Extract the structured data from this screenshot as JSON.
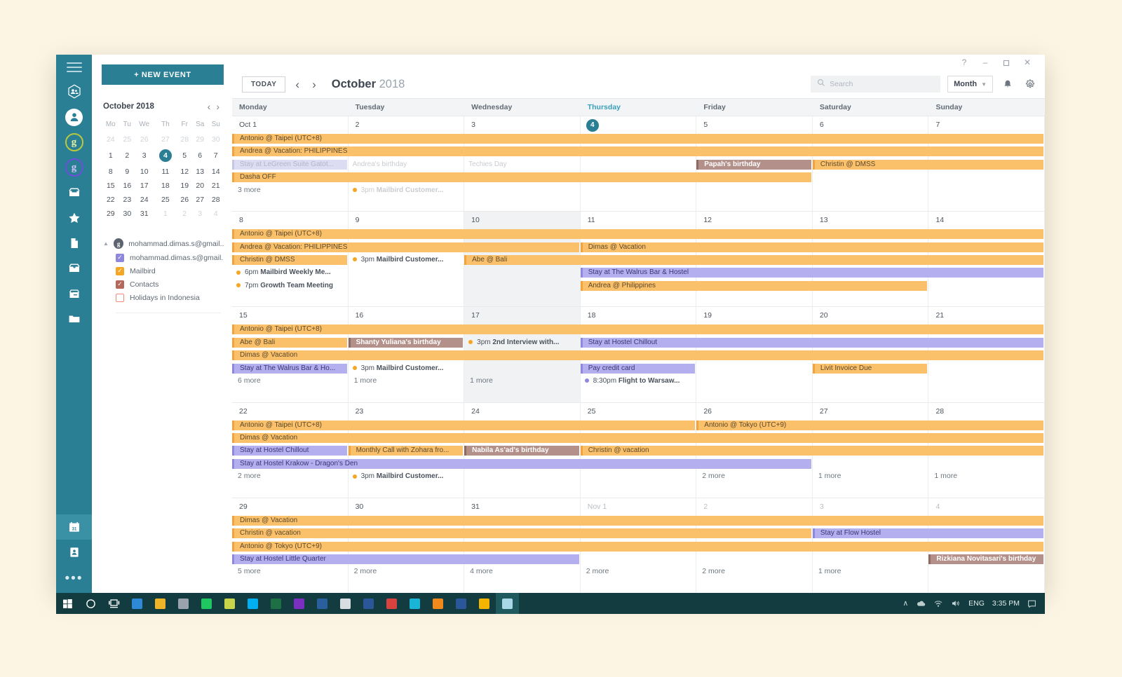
{
  "window": {
    "controls": [
      {
        "name": "help",
        "glyph": "?"
      },
      {
        "name": "minimize",
        "glyph": "–"
      },
      {
        "name": "maximize",
        "glyph": "❐"
      },
      {
        "name": "close",
        "glyph": "✕"
      }
    ]
  },
  "rail": {
    "icons": [
      {
        "name": "contacts-group-icon",
        "type": "hex-people"
      },
      {
        "name": "account-avatar-icon",
        "type": "avatar"
      },
      {
        "name": "google-account-1-icon",
        "type": "g-ring",
        "color": "#b9c93f",
        "letter": "g"
      },
      {
        "name": "google-account-2-icon",
        "type": "g-ring-violet",
        "color": "#6b4fd8",
        "letter": "g"
      },
      {
        "name": "inbox-icon",
        "type": "inbox"
      },
      {
        "name": "favorites-star-icon",
        "type": "star"
      },
      {
        "name": "drafts-page-icon",
        "type": "page"
      },
      {
        "name": "archive-icon",
        "type": "archive"
      },
      {
        "name": "snoozed-icon",
        "type": "snooze"
      },
      {
        "name": "folder-icon",
        "type": "folder"
      }
    ],
    "bottom_icons": [
      {
        "name": "calendar-icon",
        "type": "calendar",
        "active": true
      },
      {
        "name": "contacts-book-icon",
        "type": "contact-card",
        "active": false
      }
    ],
    "more_glyph": "•••"
  },
  "left_panel": {
    "new_event_label": "+ NEW EVENT",
    "mini_calendar": {
      "title": "October 2018",
      "prev_glyph": "‹",
      "next_glyph": "›",
      "weekday_headers": [
        "Mo",
        "Tu",
        "We",
        "Th",
        "Fr",
        "Sa",
        "Su"
      ],
      "weeks": [
        [
          {
            "d": "24",
            "m": true
          },
          {
            "d": "25",
            "m": true
          },
          {
            "d": "26",
            "m": true
          },
          {
            "d": "27",
            "m": true
          },
          {
            "d": "28",
            "m": true
          },
          {
            "d": "29",
            "m": true
          },
          {
            "d": "30",
            "m": true
          }
        ],
        [
          {
            "d": "1"
          },
          {
            "d": "2"
          },
          {
            "d": "3"
          },
          {
            "d": "4",
            "today": true
          },
          {
            "d": "5"
          },
          {
            "d": "6"
          },
          {
            "d": "7"
          }
        ],
        [
          {
            "d": "8"
          },
          {
            "d": "9"
          },
          {
            "d": "10"
          },
          {
            "d": "11"
          },
          {
            "d": "12"
          },
          {
            "d": "13"
          },
          {
            "d": "14"
          }
        ],
        [
          {
            "d": "15"
          },
          {
            "d": "16"
          },
          {
            "d": "17"
          },
          {
            "d": "18"
          },
          {
            "d": "19"
          },
          {
            "d": "20"
          },
          {
            "d": "21"
          }
        ],
        [
          {
            "d": "22"
          },
          {
            "d": "23"
          },
          {
            "d": "24"
          },
          {
            "d": "25"
          },
          {
            "d": "26"
          },
          {
            "d": "27"
          },
          {
            "d": "28"
          }
        ],
        [
          {
            "d": "29"
          },
          {
            "d": "30"
          },
          {
            "d": "31"
          },
          {
            "d": "1",
            "m": true
          },
          {
            "d": "2",
            "m": true
          },
          {
            "d": "3",
            "m": true
          },
          {
            "d": "4",
            "m": true
          }
        ]
      ]
    },
    "account": {
      "caret_glyph": "▲",
      "initial": "g",
      "label": "mohammad.dimas.s@gmail...."
    },
    "calendars": [
      {
        "label": "mohammad.dimas.s@gmail....",
        "checked": true,
        "color": "#8e87e0",
        "check": "✓"
      },
      {
        "label": "Mailbird",
        "checked": true,
        "color": "#f5a623",
        "check": "✓"
      },
      {
        "label": "Contacts",
        "checked": true,
        "color": "#b5675a",
        "check": "✓"
      },
      {
        "label": "Holidays in Indonesia",
        "checked": false,
        "color": "#f08a7a",
        "check": ""
      }
    ]
  },
  "toolbar": {
    "today_label": "TODAY",
    "prev_glyph": "‹",
    "next_glyph": "›",
    "month": "October",
    "year": "2018",
    "search_placeholder": "Search",
    "search_value": "",
    "search_icon": "search-icon",
    "view_label": "Month",
    "view_chevron": "▼",
    "bell_icon": "notifications-bell-icon",
    "gear_icon": "settings-gear-icon"
  },
  "calendar": {
    "weekday_headers": [
      {
        "label": "Monday",
        "today": false
      },
      {
        "label": "Tuesday",
        "today": false
      },
      {
        "label": "Wednesday",
        "today": false
      },
      {
        "label": "Thursday",
        "today": true
      },
      {
        "label": "Friday",
        "today": false
      },
      {
        "label": "Saturday",
        "today": false
      },
      {
        "label": "Sunday",
        "today": false
      }
    ],
    "weeks": [
      {
        "days": [
          {
            "num": "Oct 1"
          },
          {
            "num": "2"
          },
          {
            "num": "3"
          },
          {
            "num": "4",
            "today": true
          },
          {
            "num": "5"
          },
          {
            "num": "6"
          },
          {
            "num": "7"
          }
        ],
        "bands": [
          {
            "label": "Antonio @ Taipei (UTC+8)",
            "style": "orange",
            "start": 0,
            "span": 7,
            "row": 0
          },
          {
            "label": "Andrea @ Vacation: PHILIPPINES",
            "style": "orange",
            "start": 0,
            "span": 7,
            "row": 1
          },
          {
            "label": "Stay at LeGreen Suite Gatot...",
            "style": "lilac-faded",
            "start": 0,
            "span": 1,
            "row": 2
          },
          {
            "label": "Andrea's birthday",
            "style": "plain faded",
            "start": 1,
            "span": 1,
            "row": 2
          },
          {
            "label": "Techies Day",
            "style": "plain faded",
            "start": 2,
            "span": 1,
            "row": 2
          },
          {
            "label": "Papah's birthday",
            "style": "brown",
            "start": 4,
            "span": 1,
            "row": 2
          },
          {
            "label": "Christin @ DMSS",
            "style": "orange",
            "start": 5,
            "span": 2,
            "row": 2
          },
          {
            "label": "Dasha OFF",
            "style": "orange",
            "start": 0,
            "span": 5,
            "row": 3
          }
        ],
        "timed": [
          {
            "label": "3pm Mailbird Customer...",
            "time": "3pm",
            "name": "Mailbird Customer...",
            "dot": "orange",
            "start": 1,
            "row": 4,
            "faded": true
          }
        ],
        "more": [
          {
            "label": "3 more",
            "start": 0,
            "row": 4
          }
        ]
      },
      {
        "days": [
          {
            "num": "8"
          },
          {
            "num": "9"
          },
          {
            "num": "10",
            "shaded": true
          },
          {
            "num": "11"
          },
          {
            "num": "12"
          },
          {
            "num": "13"
          },
          {
            "num": "14"
          }
        ],
        "bands": [
          {
            "label": "Antonio @ Taipei (UTC+8)",
            "style": "orange",
            "start": 0,
            "span": 7,
            "row": 0
          },
          {
            "label": "Andrea @ Vacation: PHILIPPINES",
            "style": "orange",
            "start": 0,
            "span": 3,
            "row": 1
          },
          {
            "label": "Dimas @ Vacation",
            "style": "orange",
            "start": 3,
            "span": 4,
            "row": 1
          },
          {
            "label": "Christin @ DMSS",
            "style": "orange",
            "start": 0,
            "span": 1,
            "row": 2
          },
          {
            "label": "Abe @ Bali",
            "style": "orange",
            "start": 2,
            "span": 5,
            "row": 2
          },
          {
            "label": "Stay at The Walrus Bar & Hostel",
            "style": "purple",
            "start": 3,
            "span": 4,
            "row": 3
          },
          {
            "label": "Andrea @ Philippines",
            "style": "orange",
            "start": 3,
            "span": 3,
            "row": 4
          }
        ],
        "timed": [
          {
            "label": "3pm Mailbird Customer...",
            "time": "3pm",
            "name": "Mailbird Customer...",
            "dot": "orange",
            "start": 1,
            "row": 2
          },
          {
            "label": "6pm Mailbird Weekly Me...",
            "time": "6pm",
            "name": "Mailbird Weekly Me...",
            "dot": "orange",
            "start": 0,
            "row": 3
          },
          {
            "label": "7pm Growth Team Meeting",
            "time": "7pm",
            "name": "Growth Team Meeting",
            "dot": "orange",
            "start": 0,
            "row": 4
          }
        ],
        "more": []
      },
      {
        "days": [
          {
            "num": "15"
          },
          {
            "num": "16"
          },
          {
            "num": "17",
            "shaded": true
          },
          {
            "num": "18"
          },
          {
            "num": "19"
          },
          {
            "num": "20"
          },
          {
            "num": "21"
          }
        ],
        "bands": [
          {
            "label": "Antonio @ Taipei (UTC+8)",
            "style": "orange",
            "start": 0,
            "span": 7,
            "row": 0
          },
          {
            "label": "Abe @ Bali",
            "style": "orange",
            "start": 0,
            "span": 1,
            "row": 1
          },
          {
            "label": "Shanty Yuliana's birthday",
            "style": "brown",
            "start": 1,
            "span": 1,
            "row": 1
          },
          {
            "label": "Stay at Hostel Chillout",
            "style": "purple",
            "start": 3,
            "span": 4,
            "row": 1
          },
          {
            "label": "Dimas @ Vacation",
            "style": "orange",
            "start": 0,
            "span": 7,
            "row": 2
          },
          {
            "label": "Stay at The Walrus Bar & Ho...",
            "style": "purple",
            "start": 0,
            "span": 1,
            "row": 3
          },
          {
            "label": "Pay credit card",
            "style": "purple",
            "start": 3,
            "span": 1,
            "row": 3
          },
          {
            "label": "Livit Invoice Due",
            "style": "orange",
            "start": 5,
            "span": 1,
            "row": 3
          }
        ],
        "timed": [
          {
            "label": "3pm 2nd Interview with...",
            "time": "3pm",
            "name": "2nd Interview with...",
            "dot": "orange",
            "start": 2,
            "row": 1
          },
          {
            "label": "3pm Mailbird Customer...",
            "time": "3pm",
            "name": "Mailbird Customer...",
            "dot": "orange",
            "start": 1,
            "row": 3
          },
          {
            "label": "8:30pm Flight to Warsaw...",
            "time": "8:30pm",
            "name": "Flight to Warsaw...",
            "dot": "violet",
            "start": 3,
            "row": 4
          }
        ],
        "more": [
          {
            "label": "6 more",
            "start": 0,
            "row": 4
          },
          {
            "label": "1 more",
            "start": 1,
            "row": 4
          },
          {
            "label": "1 more",
            "start": 2,
            "row": 4
          }
        ]
      },
      {
        "days": [
          {
            "num": "22"
          },
          {
            "num": "23"
          },
          {
            "num": "24"
          },
          {
            "num": "25"
          },
          {
            "num": "26"
          },
          {
            "num": "27"
          },
          {
            "num": "28"
          }
        ],
        "bands": [
          {
            "label": "Antonio @ Taipei (UTC+8)",
            "style": "orange",
            "start": 0,
            "span": 4,
            "row": 0
          },
          {
            "label": "Antonio @ Tokyo (UTC+9)",
            "style": "orange",
            "start": 4,
            "span": 3,
            "row": 0
          },
          {
            "label": "Dimas @ Vacation",
            "style": "orange",
            "start": 0,
            "span": 7,
            "row": 1
          },
          {
            "label": "Stay at Hostel Chillout",
            "style": "purple",
            "start": 0,
            "span": 1,
            "row": 2
          },
          {
            "label": "Monthly Call with Zohara fro...",
            "style": "orange",
            "start": 1,
            "span": 1,
            "row": 2
          },
          {
            "label": "Nabila As'ad's birthday",
            "style": "brown",
            "start": 2,
            "span": 1,
            "row": 2
          },
          {
            "label": "Christin @ vacation",
            "style": "orange",
            "start": 3,
            "span": 4,
            "row": 2
          },
          {
            "label": "Stay at Hostel Krakow - Dragon's Den",
            "style": "purple",
            "start": 0,
            "span": 5,
            "row": 3
          }
        ],
        "timed": [
          {
            "label": "3pm Mailbird Customer...",
            "time": "3pm",
            "name": "Mailbird Customer...",
            "dot": "orange",
            "start": 1,
            "row": 4
          }
        ],
        "more": [
          {
            "label": "2 more",
            "start": 0,
            "row": 4
          },
          {
            "label": "2 more",
            "start": 4,
            "row": 4
          },
          {
            "label": "1 more",
            "start": 5,
            "row": 4
          },
          {
            "label": "1 more",
            "start": 6,
            "row": 4
          }
        ]
      },
      {
        "days": [
          {
            "num": "29"
          },
          {
            "num": "30"
          },
          {
            "num": "31"
          },
          {
            "num": "Nov 1",
            "muted": true
          },
          {
            "num": "2",
            "muted": true
          },
          {
            "num": "3",
            "muted": true
          },
          {
            "num": "4",
            "muted": true
          }
        ],
        "bands": [
          {
            "label": "Dimas @ Vacation",
            "style": "orange",
            "start": 0,
            "span": 7,
            "row": 0
          },
          {
            "label": "Christin @ vacation",
            "style": "orange",
            "start": 0,
            "span": 5,
            "row": 1
          },
          {
            "label": "Stay at Flow Hostel",
            "style": "purple",
            "start": 5,
            "span": 2,
            "row": 1
          },
          {
            "label": "Antonio @ Tokyo (UTC+9)",
            "style": "orange",
            "start": 0,
            "span": 7,
            "row": 2
          },
          {
            "label": "Stay at Hostel Little Quarter",
            "style": "purple",
            "start": 0,
            "span": 3,
            "row": 3
          },
          {
            "label": "Rizkiana Novitasari's birthday",
            "style": "brown",
            "start": 6,
            "span": 1,
            "row": 3
          }
        ],
        "timed": [],
        "more": [
          {
            "label": "5 more",
            "start": 0,
            "row": 4
          },
          {
            "label": "2 more",
            "start": 1,
            "row": 4
          },
          {
            "label": "4 more",
            "start": 2,
            "row": 4
          },
          {
            "label": "2 more",
            "start": 3,
            "row": 4
          },
          {
            "label": "2 more",
            "start": 4,
            "row": 4
          },
          {
            "label": "1 more",
            "start": 5,
            "row": 4
          }
        ]
      }
    ]
  },
  "taskbar": {
    "apps": [
      {
        "name": "start-button",
        "color": "#ffffff",
        "shape": "windows"
      },
      {
        "name": "cortana-search-icon",
        "color": "#ffffff",
        "shape": "circle"
      },
      {
        "name": "task-view-icon",
        "color": "#ffffff",
        "shape": "taskview"
      },
      {
        "name": "edge-icon",
        "color": "#2e8ad6"
      },
      {
        "name": "file-explorer-icon",
        "color": "#f0b429"
      },
      {
        "name": "browser-globe-icon",
        "color": "#9aa3ad"
      },
      {
        "name": "messenger-icon",
        "color": "#1ec760"
      },
      {
        "name": "notepad-icon",
        "color": "#c8d44a"
      },
      {
        "name": "skype-icon",
        "color": "#00aff0"
      },
      {
        "name": "excel-icon",
        "color": "#1d7044"
      },
      {
        "name": "onenote-icon",
        "color": "#7b2fbe"
      },
      {
        "name": "photoshop-icon",
        "color": "#2a5f9e"
      },
      {
        "name": "files-icon",
        "color": "#d8dde2"
      },
      {
        "name": "word-icon",
        "color": "#2b579a"
      },
      {
        "name": "opera-icon",
        "color": "#d9433f"
      },
      {
        "name": "handbrake-icon",
        "color": "#19b5d6"
      },
      {
        "name": "antivirus-icon",
        "color": "#f0881c"
      },
      {
        "name": "word-doc-icon",
        "color": "#2b579a"
      },
      {
        "name": "chrome-icon",
        "color": "#f4b400"
      },
      {
        "name": "mailbird-icon",
        "color": "#a8d8e8",
        "selected": true
      }
    ],
    "tray": {
      "chevron_glyph": "∧",
      "icons": [
        {
          "name": "onedrive-tray-icon"
        },
        {
          "name": "network-tray-icon"
        },
        {
          "name": "volume-tray-icon"
        }
      ],
      "language": "ENG",
      "time": "3:35 PM",
      "action_center": "notification-center-icon"
    }
  }
}
